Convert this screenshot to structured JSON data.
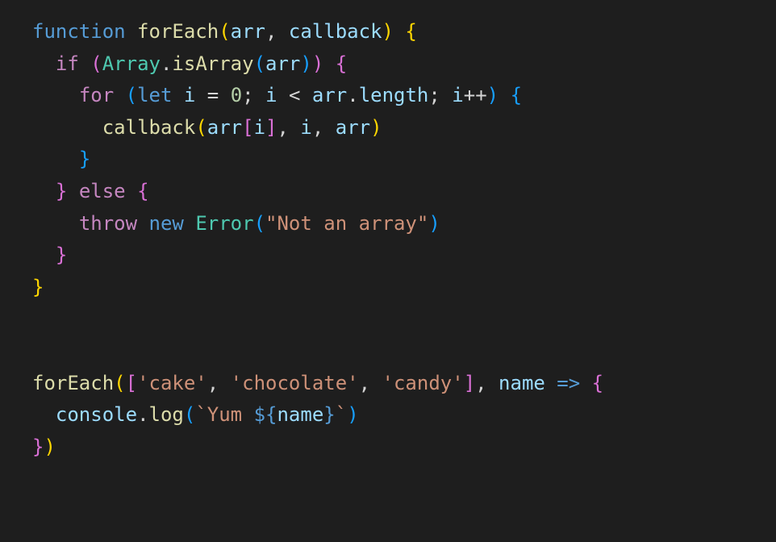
{
  "code": {
    "line1": {
      "kw_function": "function",
      "fn_name": "forEach",
      "lparen": "(",
      "param1": "arr",
      "comma1": ", ",
      "param2": "callback",
      "rparen": ")",
      "space": " ",
      "lbrace": "{"
    },
    "line2": {
      "indent": "  ",
      "guide": "",
      "kw_if": "if",
      "space1": " ",
      "lparen": "(",
      "cls": "Array",
      "dot": ".",
      "method": "isArray",
      "lparen2": "(",
      "arg": "arr",
      "rparen2": ")",
      "rparen": ")",
      "space2": " ",
      "lbrace": "{"
    },
    "line3": {
      "indent": "    ",
      "kw_for": "for",
      "space1": " ",
      "lparen": "(",
      "kw_let": "let",
      "space2": " ",
      "var_i": "i",
      "space3": " ",
      "eq": "=",
      "space4": " ",
      "zero": "0",
      "semi1": ";",
      "space5": " ",
      "var_i2": "i",
      "space6": " ",
      "lt": "<",
      "space7": " ",
      "arr": "arr",
      "dot": ".",
      "length": "length",
      "semi2": ";",
      "space8": " ",
      "var_i3": "i",
      "incr": "++",
      "rparen": ")",
      "space9": " ",
      "lbrace": "{"
    },
    "line4": {
      "indent": "      ",
      "callback": "callback",
      "lparen": "(",
      "arr": "arr",
      "lbracket": "[",
      "var_i": "i",
      "rbracket": "]",
      "comma1": ", ",
      "var_i2": "i",
      "comma2": ", ",
      "arr2": "arr",
      "rparen": ")"
    },
    "line5": {
      "indent": "    ",
      "rbrace": "}"
    },
    "line6": {
      "indent": "  ",
      "rbrace": "}",
      "space1": " ",
      "kw_else": "else",
      "space2": " ",
      "lbrace": "{"
    },
    "line7": {
      "indent": "    ",
      "kw_throw": "throw",
      "space1": " ",
      "kw_new": "new",
      "space2": " ",
      "cls": "Error",
      "lparen": "(",
      "str": "\"Not an array\"",
      "rparen": ")"
    },
    "line8": {
      "indent": "  ",
      "rbrace": "}"
    },
    "line9": {
      "rbrace": "}"
    },
    "line10": {
      "blank": ""
    },
    "line11": {
      "blank": ""
    },
    "line12": {
      "fn": "forEach",
      "lparen": "(",
      "lbracket": "[",
      "str1": "'cake'",
      "comma1": ", ",
      "str2": "'chocolate'",
      "comma2": ", ",
      "str3": "'candy'",
      "rbracket": "]",
      "comma3": ", ",
      "param": "name",
      "space1": " ",
      "arrow": "=>",
      "space2": " ",
      "lbrace": "{"
    },
    "line13": {
      "indent": "  ",
      "console": "console",
      "dot": ".",
      "log": "log",
      "lparen": "(",
      "backtick1": "`",
      "yum": "Yum ",
      "dollar_brace": "${",
      "name": "name",
      "close_brace": "}",
      "backtick2": "`",
      "rparen": ")"
    },
    "line14": {
      "rbrace": "}",
      "rparen": ")"
    }
  }
}
